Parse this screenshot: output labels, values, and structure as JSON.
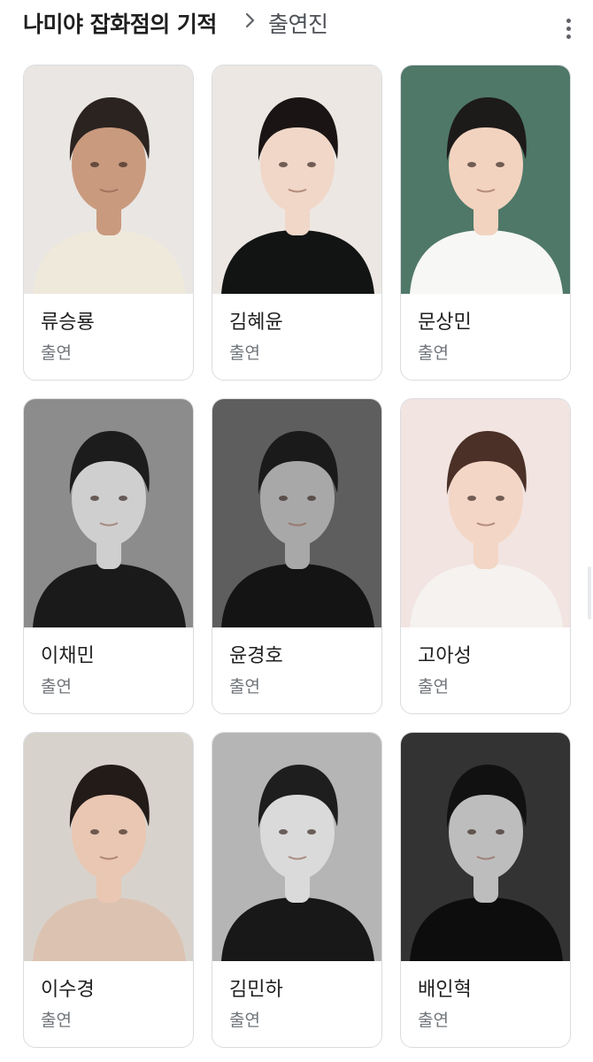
{
  "header": {
    "title": "나미야 잡화점의 기적",
    "breadcrumb_separator_icon": "chevron-right-icon",
    "breadcrumb": "출연진",
    "menu_icon": "more-vertical-icon"
  },
  "cast": [
    {
      "name": "류승룡",
      "role": "출연",
      "photo": {
        "bg": "#e9e6e3",
        "hair": "#2b2320",
        "skin": "#c99a7e",
        "top": "#efe9dc"
      }
    },
    {
      "name": "김혜윤",
      "role": "출연",
      "photo": {
        "bg": "#ece7e2",
        "hair": "#1a1514",
        "skin": "#f0d7c8",
        "top": "#121414"
      }
    },
    {
      "name": "문상민",
      "role": "출연",
      "photo": {
        "bg": "#4f7868",
        "hair": "#1d1a1a",
        "skin": "#f2d3bf",
        "top": "#f7f7f5"
      }
    },
    {
      "name": "이채민",
      "role": "출연",
      "photo": {
        "bg": "#8c8c8c",
        "hair": "#1c1c1c",
        "skin": "#cfcfcf",
        "top": "#1a1a1a"
      }
    },
    {
      "name": "윤경호",
      "role": "출연",
      "photo": {
        "bg": "#5e5e5e",
        "hair": "#1a1a1a",
        "skin": "#a8a8a8",
        "top": "#141414"
      }
    },
    {
      "name": "고아성",
      "role": "출연",
      "photo": {
        "bg": "#f1e4e1",
        "hair": "#4a3026",
        "skin": "#f3d6c6",
        "top": "#f5f2ef"
      }
    },
    {
      "name": "이수경",
      "role": "출연",
      "photo": {
        "bg": "#d8d2cc",
        "hair": "#231b18",
        "skin": "#e9c7b2",
        "top": "#dcc3b1"
      }
    },
    {
      "name": "김민하",
      "role": "출연",
      "photo": {
        "bg": "#b5b5b5",
        "hair": "#1e1e1e",
        "skin": "#dadada",
        "top": "#181818"
      }
    },
    {
      "name": "배인혁",
      "role": "출연",
      "photo": {
        "bg": "#333333",
        "hair": "#111111",
        "skin": "#bdbdbd",
        "top": "#0d0d0d"
      }
    }
  ]
}
